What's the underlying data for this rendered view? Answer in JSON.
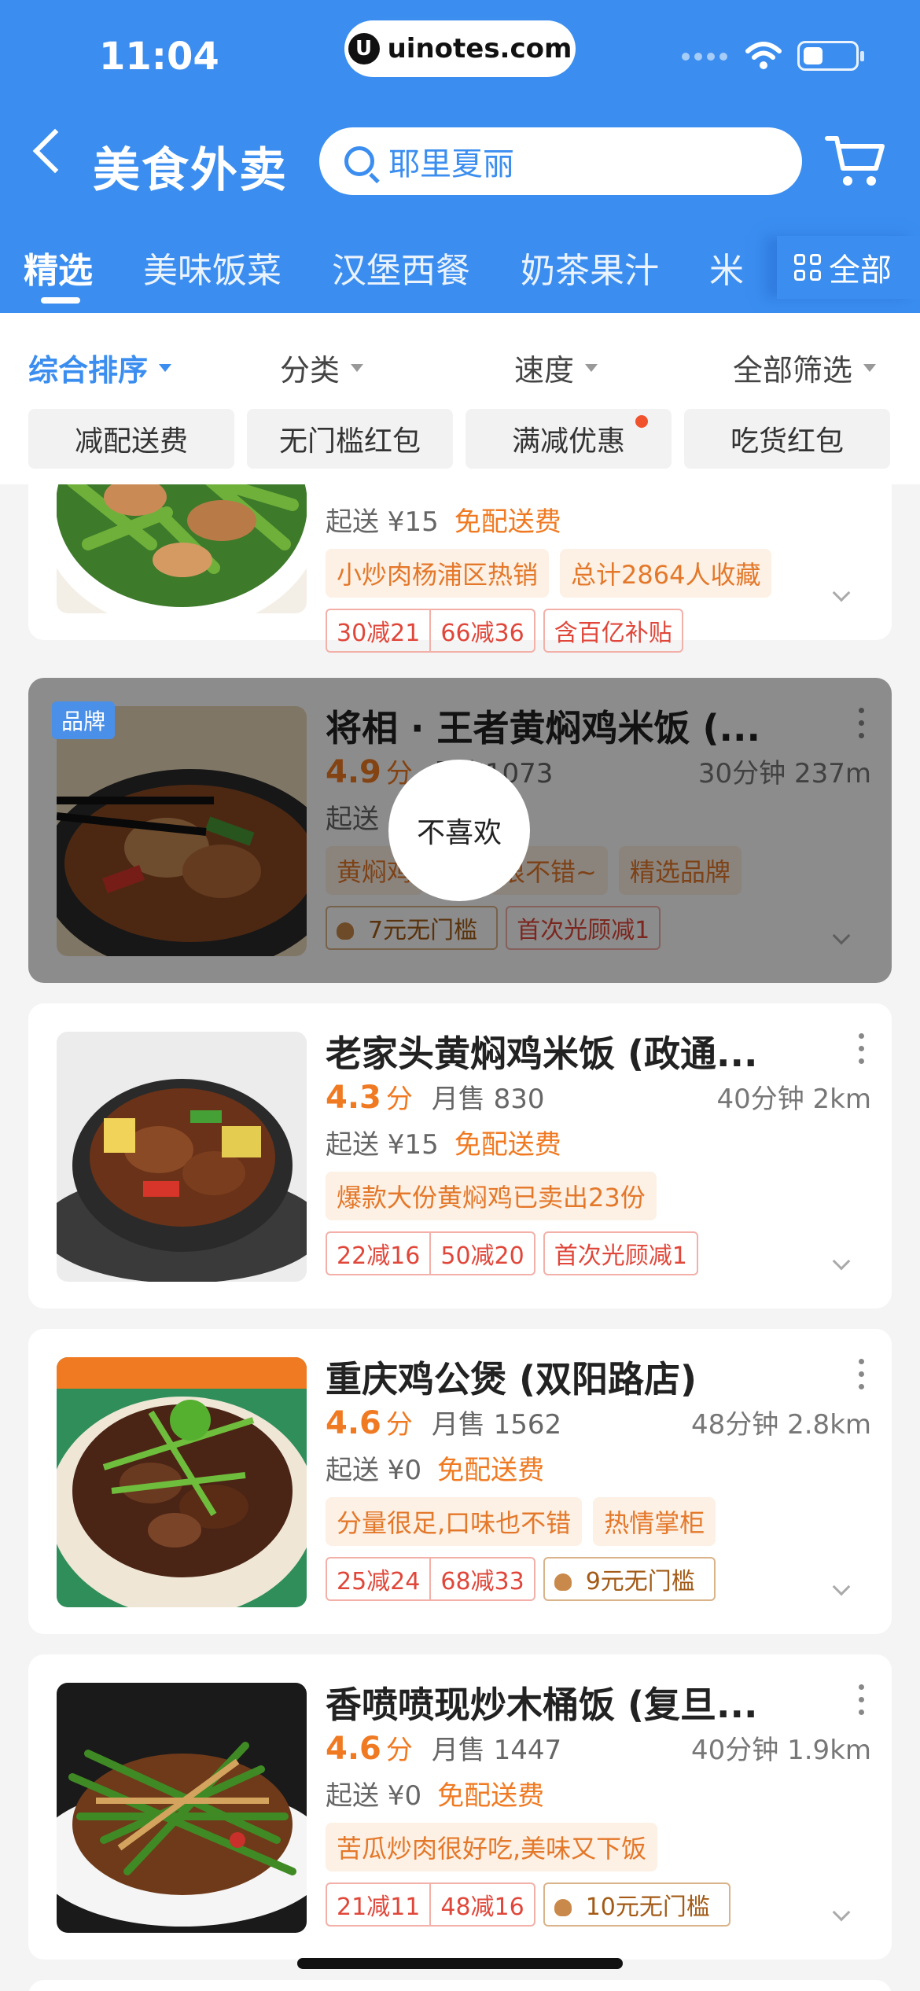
{
  "status": {
    "time": "11:04",
    "watermark": "uinotes.com"
  },
  "header": {
    "title": "美食外卖",
    "search_placeholder": "耶里夏丽"
  },
  "tabs": [
    {
      "label": "精选"
    },
    {
      "label": "美味饭菜"
    },
    {
      "label": "汉堡西餐"
    },
    {
      "label": "奶茶果汁"
    },
    {
      "label": "米"
    }
  ],
  "tab_all": "全部",
  "sorts": [
    {
      "label": "综合排序"
    },
    {
      "label": "分类"
    },
    {
      "label": "速度"
    },
    {
      "label": "全部筛选"
    }
  ],
  "chips": [
    {
      "label": "减配送费"
    },
    {
      "label": "无门槛红包"
    },
    {
      "label": "满减优惠"
    },
    {
      "label": "吃货红包"
    }
  ],
  "cards": [
    {
      "delivery": "起送 ¥15",
      "free": "免配送费",
      "tags": [
        "小炒肉杨浦区热销",
        "总计2864人收藏"
      ],
      "promos": [
        "30减21",
        "66减36"
      ],
      "promo_extra": "含百亿补贴"
    },
    {
      "badge": "品牌",
      "name": "将相 · 王者黄焖鸡米饭 (...",
      "score": "4.9",
      "score_unit": "分",
      "sales": "月售1073",
      "eta": "30分钟 237m",
      "delivery": "起送",
      "free": "费",
      "tags": [
        "黄焖鸡",
        "很不错~",
        "精选品牌"
      ],
      "promo_gold": "7元无门槛",
      "promo_extra": "首次光顾减1",
      "dislike": "不喜欢"
    },
    {
      "name": "老家头黄焖鸡米饭 (政通...",
      "score": "4.3",
      "score_unit": "分",
      "sales": "月售 830",
      "eta": "40分钟 2km",
      "delivery": "起送 ¥15",
      "free": "免配送费",
      "tags": [
        "爆款大份黄焖鸡已卖出23份"
      ],
      "promos": [
        "22减16",
        "50减20"
      ],
      "promo_extra": "首次光顾减1"
    },
    {
      "name": "重庆鸡公煲 (双阳路店)",
      "score": "4.6",
      "score_unit": "分",
      "sales": "月售 1562",
      "eta": "48分钟 2.8km",
      "delivery": "起送 ¥0",
      "free": "免配送费",
      "tags": [
        "分量很足,口味也不错",
        "热情掌柜"
      ],
      "promos": [
        "25减24",
        "68减33"
      ],
      "promo_gold": "9元无门槛"
    },
    {
      "name": "香喷喷现炒木桶饭 (复旦...",
      "score": "4.6",
      "score_unit": "分",
      "sales": "月售 1447",
      "eta": "40分钟 1.9km",
      "delivery": "起送 ¥0",
      "free": "免配送费",
      "tags": [
        "苦瓜炒肉很好吃,美味又下饭"
      ],
      "promos": [
        "21减11",
        "48减16"
      ],
      "promo_gold": "10元无门槛"
    }
  ]
}
